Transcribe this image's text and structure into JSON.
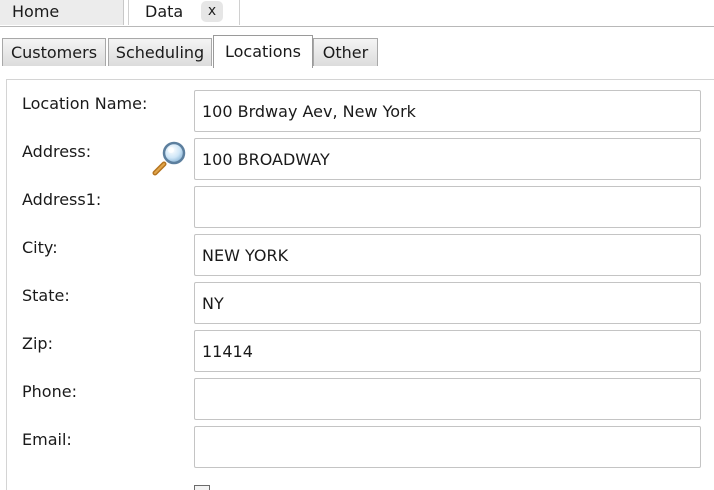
{
  "doc_tabs": {
    "home": "Home",
    "data": "Data",
    "close": "x"
  },
  "sub_tabs": [
    "Customers",
    "Scheduling",
    "Locations",
    "Other"
  ],
  "active_sub_tab": "Locations",
  "form": {
    "location_name": {
      "label": "Location Name:",
      "value": "100 Brdway Aev, New York"
    },
    "address": {
      "label": "Address:",
      "value": "100 BROADWAY"
    },
    "address1": {
      "label": "Address1:",
      "value": ""
    },
    "city": {
      "label": "City:",
      "value": "NEW YORK"
    },
    "state": {
      "label": "State:",
      "value": "NY"
    },
    "zip": {
      "label": "Zip:",
      "value": "11414"
    },
    "phone": {
      "label": "Phone:",
      "value": ""
    },
    "email": {
      "label": "Email:",
      "value": ""
    }
  },
  "icons": {
    "address_lookup": "magnifier-icon"
  },
  "colors": {
    "tab_border": "#a8a8a8",
    "input_border": "#c4c4c4"
  }
}
